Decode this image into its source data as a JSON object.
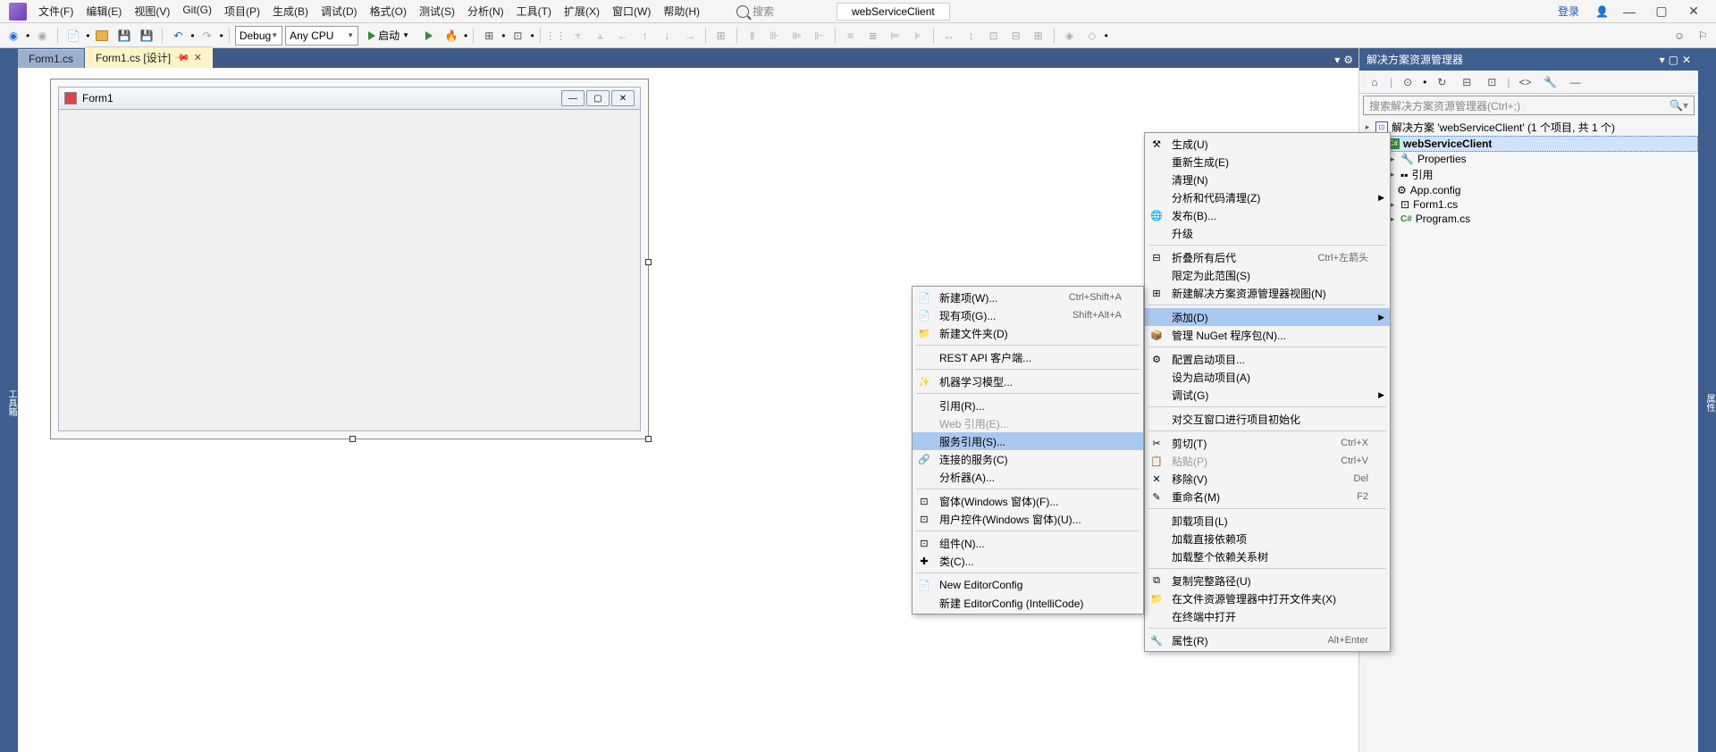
{
  "menubar": {
    "items": [
      "文件(F)",
      "编辑(E)",
      "视图(V)",
      "Git(G)",
      "项目(P)",
      "生成(B)",
      "调试(D)",
      "格式(O)",
      "测试(S)",
      "分析(N)",
      "工具(T)",
      "扩展(X)",
      "窗口(W)",
      "帮助(H)"
    ],
    "search_placeholder": "搜索",
    "app_name": "webServiceClient",
    "login": "登录"
  },
  "toolbar": {
    "config": "Debug",
    "platform": "Any CPU",
    "start_label": "启动"
  },
  "tabs": {
    "items": [
      {
        "label": "Form1.cs",
        "active": false
      },
      {
        "label": "Form1.cs [设计]",
        "active": true
      }
    ]
  },
  "designer": {
    "form_title": "Form1"
  },
  "solution": {
    "panel_title": "解决方案资源管理器",
    "search_placeholder": "搜索解决方案资源管理器(Ctrl+;)",
    "root": "解决方案 'webServiceClient' (1 个项目, 共 1 个)",
    "project": "webServiceClient",
    "nodes": [
      "Properties",
      "引用",
      "App.config",
      "Form1.cs",
      "Program.cs"
    ]
  },
  "left_gutter": "工具箱",
  "right_gutter": "属性",
  "context_main": {
    "items": [
      {
        "icon": "build",
        "label": "生成(U)"
      },
      {
        "label": "重新生成(E)"
      },
      {
        "label": "清理(N)"
      },
      {
        "label": "分析和代码清理(Z)",
        "arrow": true
      },
      {
        "icon": "globe",
        "label": "发布(B)..."
      },
      {
        "label": "升级"
      },
      {
        "sep": true
      },
      {
        "icon": "collapse",
        "label": "折叠所有后代",
        "shortcut": "Ctrl+左箭头"
      },
      {
        "label": "限定为此范围(S)"
      },
      {
        "icon": "newview",
        "label": "新建解决方案资源管理器视图(N)"
      },
      {
        "sep": true
      },
      {
        "label": "添加(D)",
        "arrow": true,
        "highlighted": true
      },
      {
        "icon": "nuget",
        "label": "管理 NuGet 程序包(N)..."
      },
      {
        "sep": true
      },
      {
        "icon": "gear",
        "label": "配置启动项目..."
      },
      {
        "label": "设为启动项目(A)"
      },
      {
        "label": "调试(G)",
        "arrow": true
      },
      {
        "sep": true
      },
      {
        "label": "对交互窗口进行项目初始化"
      },
      {
        "sep": true
      },
      {
        "icon": "cut",
        "label": "剪切(T)",
        "shortcut": "Ctrl+X"
      },
      {
        "icon": "paste",
        "label": "粘贴(P)",
        "shortcut": "Ctrl+V",
        "disabled": true
      },
      {
        "icon": "remove",
        "label": "移除(V)",
        "shortcut": "Del"
      },
      {
        "icon": "rename",
        "label": "重命名(M)",
        "shortcut": "F2"
      },
      {
        "sep": true
      },
      {
        "label": "卸载项目(L)"
      },
      {
        "label": "加载直接依赖项"
      },
      {
        "label": "加载整个依赖关系树"
      },
      {
        "sep": true
      },
      {
        "icon": "copy",
        "label": "复制完整路径(U)"
      },
      {
        "icon": "openfolder",
        "label": "在文件资源管理器中打开文件夹(X)"
      },
      {
        "label": "在终端中打开"
      },
      {
        "sep": true
      },
      {
        "icon": "wrench",
        "label": "属性(R)",
        "shortcut": "Alt+Enter"
      }
    ]
  },
  "context_sub": {
    "items": [
      {
        "icon": "newitem",
        "label": "新建项(W)...",
        "shortcut": "Ctrl+Shift+A"
      },
      {
        "icon": "existitem",
        "label": "现有项(G)...",
        "shortcut": "Shift+Alt+A"
      },
      {
        "icon": "folder",
        "label": "新建文件夹(D)"
      },
      {
        "sep": true
      },
      {
        "label": "REST API 客户端..."
      },
      {
        "sep": true
      },
      {
        "icon": "ml",
        "label": "机器学习模型..."
      },
      {
        "sep": true
      },
      {
        "label": "引用(R)..."
      },
      {
        "label": "Web 引用(E)...",
        "disabled": true
      },
      {
        "label": "服务引用(S)...",
        "highlighted": true
      },
      {
        "icon": "connect",
        "label": "连接的服务(C)"
      },
      {
        "label": "分析器(A)..."
      },
      {
        "sep": true
      },
      {
        "icon": "form",
        "label": "窗体(Windows 窗体)(F)..."
      },
      {
        "icon": "control",
        "label": "用户控件(Windows 窗体)(U)..."
      },
      {
        "sep": true
      },
      {
        "icon": "comp",
        "label": "组件(N)..."
      },
      {
        "icon": "class",
        "label": "类(C)..."
      },
      {
        "sep": true
      },
      {
        "icon": "editorconfig",
        "label": "New EditorConfig"
      },
      {
        "label": "新建 EditorConfig (IntelliCode)"
      }
    ]
  }
}
